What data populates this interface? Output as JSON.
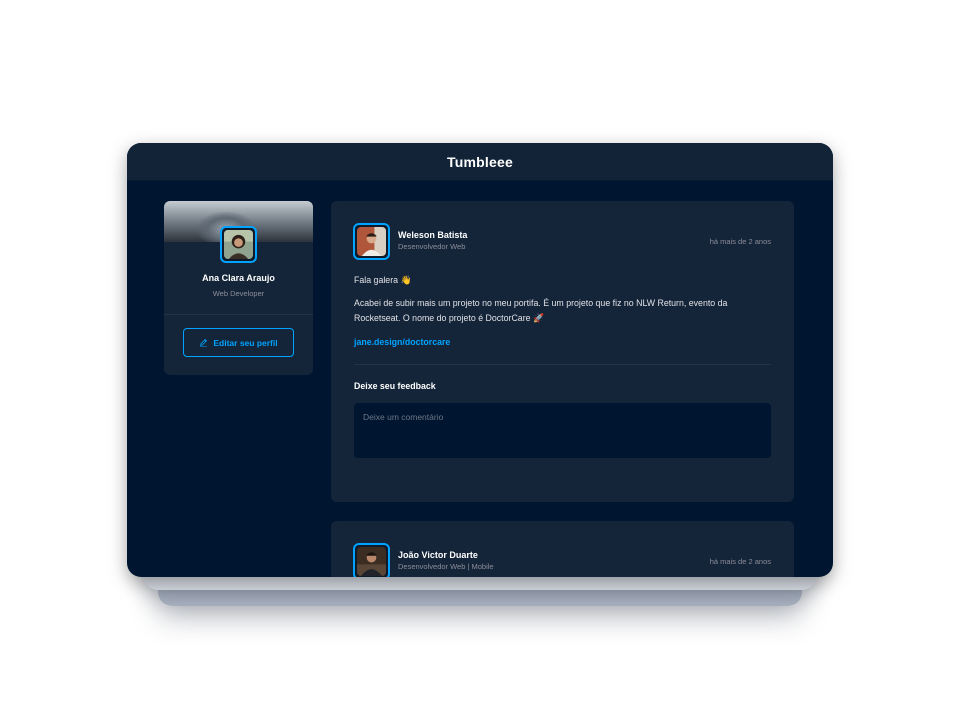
{
  "app": {
    "title": "Tumbleee"
  },
  "profile": {
    "name": "Ana Clara Araujo",
    "role": "Web Developer",
    "edit_label": "Editar seu perfil"
  },
  "posts": [
    {
      "author": "Weleson Batista",
      "role": "Desenvolvedor Web",
      "time": "há mais de 2 anos",
      "greeting": "Fala galera 👋",
      "body": "Acabei de subir mais um projeto no meu portifa. É um projeto que fiz no NLW Return, evento da Rocketseat. O nome do projeto é DoctorCare 🚀",
      "link": "jane.design/doctorcare",
      "feedback_title": "Deixe seu feedback",
      "comment_placeholder": "Deixe um comentário"
    },
    {
      "author": "João Victor Duarte",
      "role": "Desenvolvedor Web | Mobile",
      "time": "há mais de 2 anos"
    }
  ],
  "colors": {
    "background": "#00152f",
    "card": "#142539",
    "accent": "#00a3ff",
    "text_muted": "#8d8d99"
  },
  "icons": {
    "edit": "pencil-icon"
  }
}
